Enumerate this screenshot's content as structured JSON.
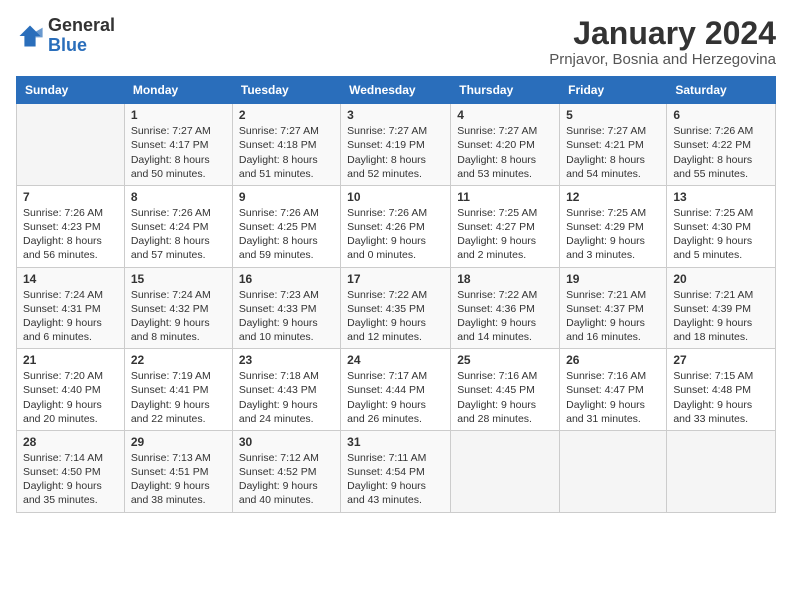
{
  "header": {
    "logo_general": "General",
    "logo_blue": "Blue",
    "month": "January 2024",
    "location": "Prnjavor, Bosnia and Herzegovina"
  },
  "weekdays": [
    "Sunday",
    "Monday",
    "Tuesday",
    "Wednesday",
    "Thursday",
    "Friday",
    "Saturday"
  ],
  "weeks": [
    [
      {
        "day": "",
        "info": ""
      },
      {
        "day": "1",
        "info": "Sunrise: 7:27 AM\nSunset: 4:17 PM\nDaylight: 8 hours\nand 50 minutes."
      },
      {
        "day": "2",
        "info": "Sunrise: 7:27 AM\nSunset: 4:18 PM\nDaylight: 8 hours\nand 51 minutes."
      },
      {
        "day": "3",
        "info": "Sunrise: 7:27 AM\nSunset: 4:19 PM\nDaylight: 8 hours\nand 52 minutes."
      },
      {
        "day": "4",
        "info": "Sunrise: 7:27 AM\nSunset: 4:20 PM\nDaylight: 8 hours\nand 53 minutes."
      },
      {
        "day": "5",
        "info": "Sunrise: 7:27 AM\nSunset: 4:21 PM\nDaylight: 8 hours\nand 54 minutes."
      },
      {
        "day": "6",
        "info": "Sunrise: 7:26 AM\nSunset: 4:22 PM\nDaylight: 8 hours\nand 55 minutes."
      }
    ],
    [
      {
        "day": "7",
        "info": "Sunrise: 7:26 AM\nSunset: 4:23 PM\nDaylight: 8 hours\nand 56 minutes."
      },
      {
        "day": "8",
        "info": "Sunrise: 7:26 AM\nSunset: 4:24 PM\nDaylight: 8 hours\nand 57 minutes."
      },
      {
        "day": "9",
        "info": "Sunrise: 7:26 AM\nSunset: 4:25 PM\nDaylight: 8 hours\nand 59 minutes."
      },
      {
        "day": "10",
        "info": "Sunrise: 7:26 AM\nSunset: 4:26 PM\nDaylight: 9 hours\nand 0 minutes."
      },
      {
        "day": "11",
        "info": "Sunrise: 7:25 AM\nSunset: 4:27 PM\nDaylight: 9 hours\nand 2 minutes."
      },
      {
        "day": "12",
        "info": "Sunrise: 7:25 AM\nSunset: 4:29 PM\nDaylight: 9 hours\nand 3 minutes."
      },
      {
        "day": "13",
        "info": "Sunrise: 7:25 AM\nSunset: 4:30 PM\nDaylight: 9 hours\nand 5 minutes."
      }
    ],
    [
      {
        "day": "14",
        "info": "Sunrise: 7:24 AM\nSunset: 4:31 PM\nDaylight: 9 hours\nand 6 minutes."
      },
      {
        "day": "15",
        "info": "Sunrise: 7:24 AM\nSunset: 4:32 PM\nDaylight: 9 hours\nand 8 minutes."
      },
      {
        "day": "16",
        "info": "Sunrise: 7:23 AM\nSunset: 4:33 PM\nDaylight: 9 hours\nand 10 minutes."
      },
      {
        "day": "17",
        "info": "Sunrise: 7:22 AM\nSunset: 4:35 PM\nDaylight: 9 hours\nand 12 minutes."
      },
      {
        "day": "18",
        "info": "Sunrise: 7:22 AM\nSunset: 4:36 PM\nDaylight: 9 hours\nand 14 minutes."
      },
      {
        "day": "19",
        "info": "Sunrise: 7:21 AM\nSunset: 4:37 PM\nDaylight: 9 hours\nand 16 minutes."
      },
      {
        "day": "20",
        "info": "Sunrise: 7:21 AM\nSunset: 4:39 PM\nDaylight: 9 hours\nand 18 minutes."
      }
    ],
    [
      {
        "day": "21",
        "info": "Sunrise: 7:20 AM\nSunset: 4:40 PM\nDaylight: 9 hours\nand 20 minutes."
      },
      {
        "day": "22",
        "info": "Sunrise: 7:19 AM\nSunset: 4:41 PM\nDaylight: 9 hours\nand 22 minutes."
      },
      {
        "day": "23",
        "info": "Sunrise: 7:18 AM\nSunset: 4:43 PM\nDaylight: 9 hours\nand 24 minutes."
      },
      {
        "day": "24",
        "info": "Sunrise: 7:17 AM\nSunset: 4:44 PM\nDaylight: 9 hours\nand 26 minutes."
      },
      {
        "day": "25",
        "info": "Sunrise: 7:16 AM\nSunset: 4:45 PM\nDaylight: 9 hours\nand 28 minutes."
      },
      {
        "day": "26",
        "info": "Sunrise: 7:16 AM\nSunset: 4:47 PM\nDaylight: 9 hours\nand 31 minutes."
      },
      {
        "day": "27",
        "info": "Sunrise: 7:15 AM\nSunset: 4:48 PM\nDaylight: 9 hours\nand 33 minutes."
      }
    ],
    [
      {
        "day": "28",
        "info": "Sunrise: 7:14 AM\nSunset: 4:50 PM\nDaylight: 9 hours\nand 35 minutes."
      },
      {
        "day": "29",
        "info": "Sunrise: 7:13 AM\nSunset: 4:51 PM\nDaylight: 9 hours\nand 38 minutes."
      },
      {
        "day": "30",
        "info": "Sunrise: 7:12 AM\nSunset: 4:52 PM\nDaylight: 9 hours\nand 40 minutes."
      },
      {
        "day": "31",
        "info": "Sunrise: 7:11 AM\nSunset: 4:54 PM\nDaylight: 9 hours\nand 43 minutes."
      },
      {
        "day": "",
        "info": ""
      },
      {
        "day": "",
        "info": ""
      },
      {
        "day": "",
        "info": ""
      }
    ]
  ]
}
